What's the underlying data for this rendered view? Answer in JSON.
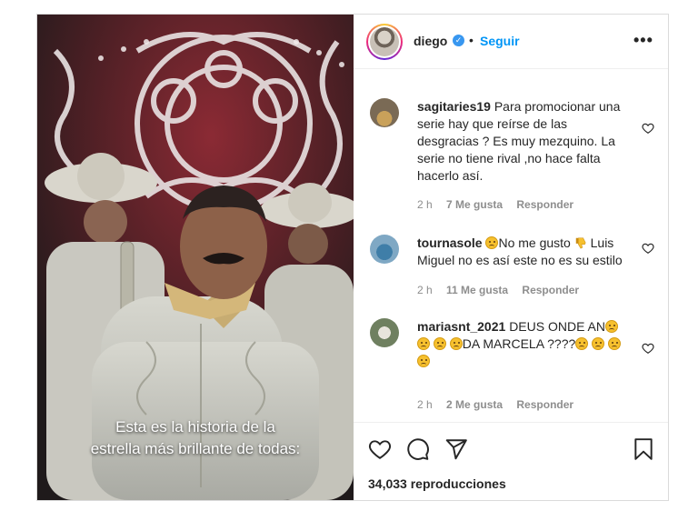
{
  "header": {
    "username": "diego",
    "separator": "•",
    "follow_label": "Seguir",
    "more_label": "•••",
    "clipped_text": "..."
  },
  "video": {
    "caption_line1": "Esta es la historia de la",
    "caption_line2": "estrella más brillante de todas:"
  },
  "comments": [
    {
      "username": "sagitaries19",
      "text": "Para promocionar una serie hay que reírse de las desgracias ? Es muy mezquino. La serie no tiene rival ,no hace falta hacerlo así.",
      "time": "2 h",
      "likes": "7 Me gusta",
      "reply": "Responder"
    },
    {
      "username": "tournasole",
      "text_after_emoji": "No me gusto",
      "text_after_thumb": "Luis Miguel no es así este no es su estilo",
      "time": "2 h",
      "likes": "11 Me gusta",
      "reply": "Responder"
    },
    {
      "username": "mariasnt_2021",
      "text_part1": "DEUS ONDE AN",
      "text_part2": "DA MARCELA ????",
      "time": "2 h",
      "likes": "2 Me gusta",
      "reply": "Responder"
    }
  ],
  "footer": {
    "views": "34,033 reproducciones"
  },
  "icons": [
    "verified-badge-icon",
    "heart-icon",
    "comment-icon",
    "share-icon",
    "bookmark-icon",
    "sad-face-emoji",
    "thumbs-down-emoji"
  ],
  "colors": {
    "accent": "#0095f6",
    "verified": "#3897f0",
    "muted": "#8e8e8e"
  }
}
